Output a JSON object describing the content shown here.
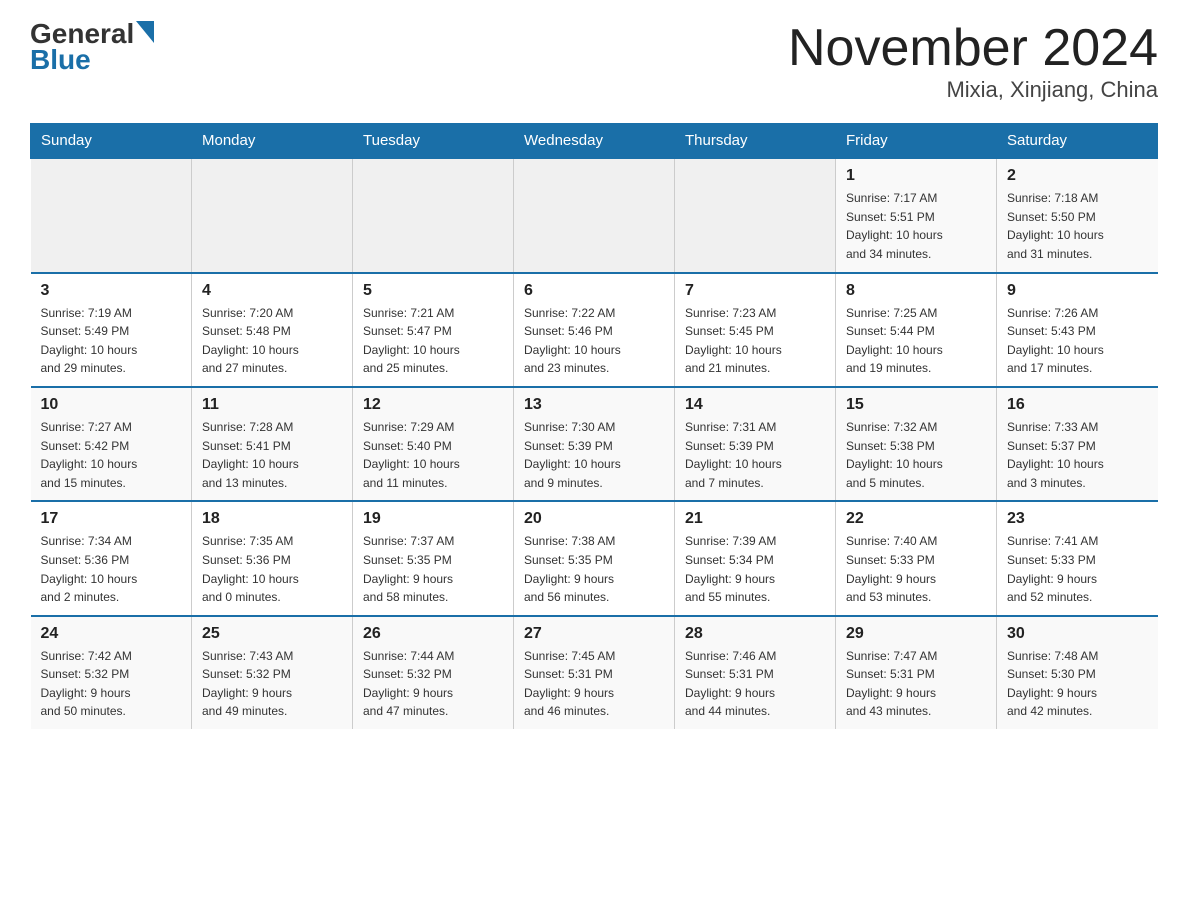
{
  "header": {
    "logo_general": "General",
    "logo_blue": "Blue",
    "month_title": "November 2024",
    "location": "Mixia, Xinjiang, China"
  },
  "weekdays": [
    "Sunday",
    "Monday",
    "Tuesday",
    "Wednesday",
    "Thursday",
    "Friday",
    "Saturday"
  ],
  "weeks": [
    [
      {
        "day": "",
        "info": ""
      },
      {
        "day": "",
        "info": ""
      },
      {
        "day": "",
        "info": ""
      },
      {
        "day": "",
        "info": ""
      },
      {
        "day": "",
        "info": ""
      },
      {
        "day": "1",
        "info": "Sunrise: 7:17 AM\nSunset: 5:51 PM\nDaylight: 10 hours\nand 34 minutes."
      },
      {
        "day": "2",
        "info": "Sunrise: 7:18 AM\nSunset: 5:50 PM\nDaylight: 10 hours\nand 31 minutes."
      }
    ],
    [
      {
        "day": "3",
        "info": "Sunrise: 7:19 AM\nSunset: 5:49 PM\nDaylight: 10 hours\nand 29 minutes."
      },
      {
        "day": "4",
        "info": "Sunrise: 7:20 AM\nSunset: 5:48 PM\nDaylight: 10 hours\nand 27 minutes."
      },
      {
        "day": "5",
        "info": "Sunrise: 7:21 AM\nSunset: 5:47 PM\nDaylight: 10 hours\nand 25 minutes."
      },
      {
        "day": "6",
        "info": "Sunrise: 7:22 AM\nSunset: 5:46 PM\nDaylight: 10 hours\nand 23 minutes."
      },
      {
        "day": "7",
        "info": "Sunrise: 7:23 AM\nSunset: 5:45 PM\nDaylight: 10 hours\nand 21 minutes."
      },
      {
        "day": "8",
        "info": "Sunrise: 7:25 AM\nSunset: 5:44 PM\nDaylight: 10 hours\nand 19 minutes."
      },
      {
        "day": "9",
        "info": "Sunrise: 7:26 AM\nSunset: 5:43 PM\nDaylight: 10 hours\nand 17 minutes."
      }
    ],
    [
      {
        "day": "10",
        "info": "Sunrise: 7:27 AM\nSunset: 5:42 PM\nDaylight: 10 hours\nand 15 minutes."
      },
      {
        "day": "11",
        "info": "Sunrise: 7:28 AM\nSunset: 5:41 PM\nDaylight: 10 hours\nand 13 minutes."
      },
      {
        "day": "12",
        "info": "Sunrise: 7:29 AM\nSunset: 5:40 PM\nDaylight: 10 hours\nand 11 minutes."
      },
      {
        "day": "13",
        "info": "Sunrise: 7:30 AM\nSunset: 5:39 PM\nDaylight: 10 hours\nand 9 minutes."
      },
      {
        "day": "14",
        "info": "Sunrise: 7:31 AM\nSunset: 5:39 PM\nDaylight: 10 hours\nand 7 minutes."
      },
      {
        "day": "15",
        "info": "Sunrise: 7:32 AM\nSunset: 5:38 PM\nDaylight: 10 hours\nand 5 minutes."
      },
      {
        "day": "16",
        "info": "Sunrise: 7:33 AM\nSunset: 5:37 PM\nDaylight: 10 hours\nand 3 minutes."
      }
    ],
    [
      {
        "day": "17",
        "info": "Sunrise: 7:34 AM\nSunset: 5:36 PM\nDaylight: 10 hours\nand 2 minutes."
      },
      {
        "day": "18",
        "info": "Sunrise: 7:35 AM\nSunset: 5:36 PM\nDaylight: 10 hours\nand 0 minutes."
      },
      {
        "day": "19",
        "info": "Sunrise: 7:37 AM\nSunset: 5:35 PM\nDaylight: 9 hours\nand 58 minutes."
      },
      {
        "day": "20",
        "info": "Sunrise: 7:38 AM\nSunset: 5:35 PM\nDaylight: 9 hours\nand 56 minutes."
      },
      {
        "day": "21",
        "info": "Sunrise: 7:39 AM\nSunset: 5:34 PM\nDaylight: 9 hours\nand 55 minutes."
      },
      {
        "day": "22",
        "info": "Sunrise: 7:40 AM\nSunset: 5:33 PM\nDaylight: 9 hours\nand 53 minutes."
      },
      {
        "day": "23",
        "info": "Sunrise: 7:41 AM\nSunset: 5:33 PM\nDaylight: 9 hours\nand 52 minutes."
      }
    ],
    [
      {
        "day": "24",
        "info": "Sunrise: 7:42 AM\nSunset: 5:32 PM\nDaylight: 9 hours\nand 50 minutes."
      },
      {
        "day": "25",
        "info": "Sunrise: 7:43 AM\nSunset: 5:32 PM\nDaylight: 9 hours\nand 49 minutes."
      },
      {
        "day": "26",
        "info": "Sunrise: 7:44 AM\nSunset: 5:32 PM\nDaylight: 9 hours\nand 47 minutes."
      },
      {
        "day": "27",
        "info": "Sunrise: 7:45 AM\nSunset: 5:31 PM\nDaylight: 9 hours\nand 46 minutes."
      },
      {
        "day": "28",
        "info": "Sunrise: 7:46 AM\nSunset: 5:31 PM\nDaylight: 9 hours\nand 44 minutes."
      },
      {
        "day": "29",
        "info": "Sunrise: 7:47 AM\nSunset: 5:31 PM\nDaylight: 9 hours\nand 43 minutes."
      },
      {
        "day": "30",
        "info": "Sunrise: 7:48 AM\nSunset: 5:30 PM\nDaylight: 9 hours\nand 42 minutes."
      }
    ]
  ]
}
